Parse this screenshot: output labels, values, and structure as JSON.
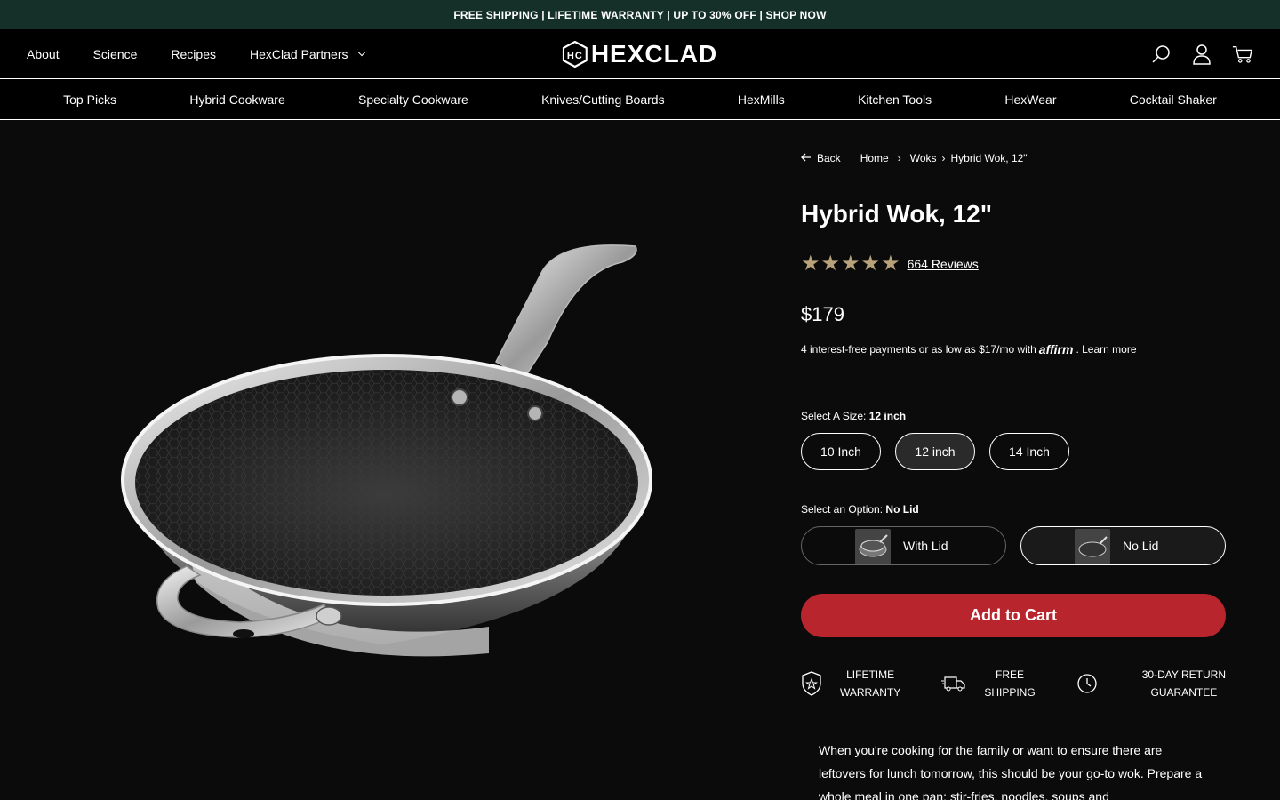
{
  "promo": {
    "text": "FREE SHIPPING | LIFETIME WARRANTY | UP TO 30% OFF | SHOP NOW"
  },
  "header": {
    "nav": [
      "About",
      "Science",
      "Recipes",
      "HexClad Partners"
    ],
    "logo": "HEXCLAD",
    "icons": [
      "search-icon",
      "account-icon",
      "cart-icon"
    ]
  },
  "categories": [
    "Top Picks",
    "Hybrid Cookware",
    "Specialty Cookware",
    "Knives/Cutting Boards",
    "HexMills",
    "Kitchen Tools",
    "HexWear",
    "Cocktail Shaker"
  ],
  "breadcrumb": {
    "back": "Back",
    "home": "Home",
    "woks": "Woks",
    "current": "Hybrid Wok, 12\""
  },
  "product": {
    "title": "Hybrid Wok, 12\"",
    "rating": 5,
    "reviews": "664 Reviews",
    "price": "$179",
    "affirm_text": "4 interest-free payments or as low as $17/mo with",
    "affirm_logo": "affirm",
    "affirm_learn": ". Learn more",
    "size_label": "Select A Size:",
    "size_selected": "12 inch",
    "sizes": [
      "10 Inch",
      "12 inch",
      "14 Inch"
    ],
    "option_label": "Select an Option:",
    "option_selected": "No Lid",
    "options": [
      "With Lid",
      "No Lid"
    ],
    "add_to_cart": "Add to Cart",
    "perks": [
      {
        "line1": "LIFETIME",
        "line2": "WARRANTY"
      },
      {
        "line1": "FREE",
        "line2": "SHIPPING"
      },
      {
        "line1": "30-DAY RETURN",
        "line2": "GUARANTEE"
      }
    ],
    "description": "When you're cooking for the family or want to ensure there are leftovers for lunch tomorrow, this should be your go-to wok. Prepare a whole meal in one pan: stir-fries, noodles, soups and"
  },
  "colors": {
    "promo_bg": "#153028",
    "accent_red": "#b8252d",
    "star_gold": "#b7a27a"
  }
}
